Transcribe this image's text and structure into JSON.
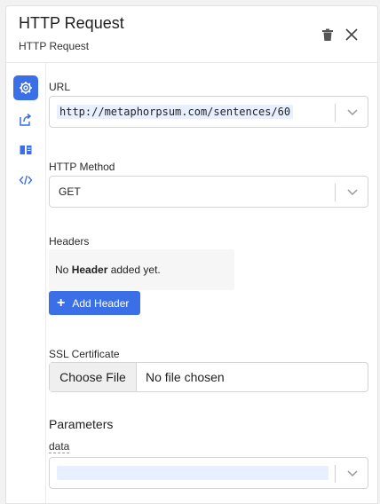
{
  "header": {
    "title": "HTTP Request",
    "subtitle": "HTTP Request"
  },
  "icons": {
    "delete": "trash-icon",
    "close": "close-icon",
    "settings": "gear-icon",
    "output": "export-icon",
    "docs": "book-icon",
    "code": "code-icon"
  },
  "url": {
    "label": "URL",
    "value": "http://metaphorpsum.com/sentences/60"
  },
  "method": {
    "label": "HTTP Method",
    "value": "GET"
  },
  "headers": {
    "label": "Headers",
    "empty_prefix": "No ",
    "empty_strong": "Header",
    "empty_suffix": " added yet.",
    "add_label": "Add Header"
  },
  "ssl": {
    "label": "SSL Certificate",
    "choose_label": "Choose File",
    "status": "No file chosen"
  },
  "parameters": {
    "title": "Parameters",
    "data_label": "data"
  },
  "colors": {
    "accent": "#3b6fe8",
    "highlight": "#e8efff"
  }
}
